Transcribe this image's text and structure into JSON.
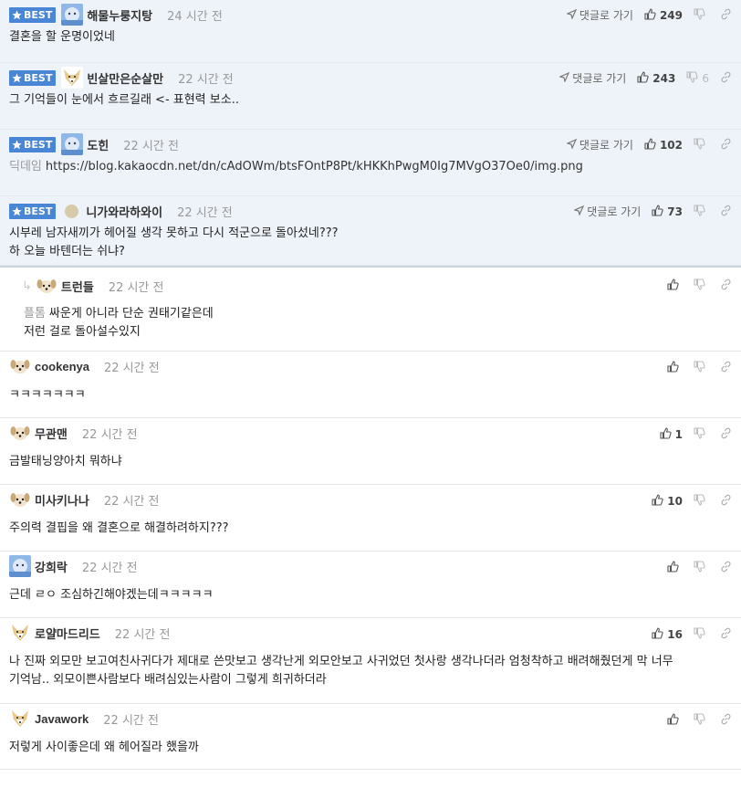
{
  "ui": {
    "best_label": "BEST",
    "goto_label": "댓글로 가기"
  },
  "comments": [
    {
      "best": true,
      "nick": "해물누룽지탕",
      "time": "24 시간 전",
      "likes": "249",
      "dislikes": "",
      "text": "결혼을 할 운명이었네",
      "avatar": "blue-avatar-icon"
    },
    {
      "best": true,
      "nick": "빈살만은순살만",
      "time": "22 시간 전",
      "likes": "243",
      "dislikes": "6",
      "text": "그 기억들이 눈에서 흐르길래 <- 표현력 보소..",
      "avatar": "fox-avatar-icon"
    },
    {
      "best": true,
      "nick": "도힌",
      "time": "22 시간 전",
      "likes": "102",
      "dislikes": "",
      "prefix": "딕데임",
      "text": "https://blog.kakaocdn.net/dn/cAdOWm/btsFOntP8Pt/kHKKhPwgM0Ig7MVgO37Oe0/img.png",
      "avatar": "blue-avatar-icon"
    },
    {
      "best": true,
      "nick": "니가와라하와이",
      "time": "22 시간 전",
      "likes": "73",
      "dislikes": "",
      "text": "시부레 남자새끼가 헤어질 생각 못하고 다시 적군으로 돌아섰네???",
      "text2": "하 오늘 바텐더는 쉬냐?",
      "avatar": "circle"
    },
    {
      "reply": true,
      "nick": "트런들",
      "time": "22 시간 전",
      "likes": "",
      "dislikes": "",
      "prefix": "플톰",
      "text": "싸운게 아니라 단순 권태기같은데",
      "text2": "저런 걸로 돌아설수있지",
      "avatar": "dog-avatar-icon"
    },
    {
      "nick": "cookenya",
      "time": "22 시간 전",
      "likes": "",
      "dislikes": "",
      "text": "ㅋㅋㅋㅋㅋㅋㅋ",
      "avatar": "dog-avatar-icon"
    },
    {
      "nick": "무관맨",
      "time": "22 시간 전",
      "likes": "1",
      "dislikes": "",
      "text": "금발태닝양아치 뭐하냐",
      "avatar": "dog-avatar-icon"
    },
    {
      "nick": "미사키나나",
      "time": "22 시간 전",
      "likes": "10",
      "dislikes": "",
      "text": "주의력 결핍을 왜 결혼으로 해결하려하지???",
      "avatar": "dog-avatar-icon"
    },
    {
      "nick": "강희락",
      "time": "22 시간 전",
      "likes": "",
      "dislikes": "",
      "text": "근데 ㄹㅇ 조심하긴해야겠는데ㅋㅋㅋㅋㅋ",
      "avatar": "blue-avatar-icon"
    },
    {
      "nick": "로얄마드리드",
      "time": "22 시간 전",
      "likes": "16",
      "dislikes": "",
      "text": "나 진짜 외모만 보고여친사귀다가 제대로 쓴맛보고 생각난게 외모안보고 사귀었던 첫사랑 생각나더라 엄청착하고 배려해줬던게 막 너무",
      "text2": "기억남.. 외모이쁜사람보다 배려심있는사람이 그렇게 희귀하더라",
      "avatar": "fox-avatar-icon"
    },
    {
      "nick": "Javawork",
      "time": "22 시간 전",
      "likes": "",
      "dislikes": "",
      "text": "저렇게 사이좋은데 왜 헤어질라 했을까",
      "avatar": "fox-avatar-icon"
    }
  ]
}
